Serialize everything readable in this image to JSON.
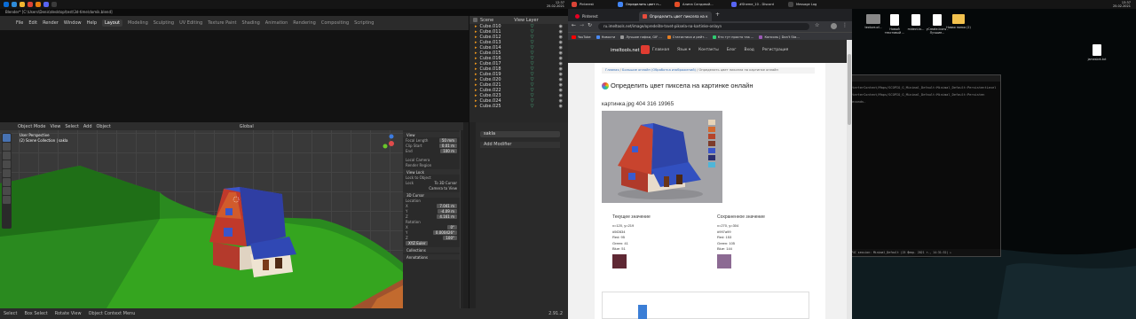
{
  "left_taskbar": {
    "clock_time": "12:37",
    "clock_date": "25.02.2021",
    "lang": "РУС"
  },
  "blender": {
    "window_title": "Blender* [C:\\Users\\Denis\\desktop\\test\\3d-time\\domik.blend]",
    "menus": [
      "File",
      "Edit",
      "Render",
      "Window",
      "Help"
    ],
    "workspaces": [
      "Layout",
      "Modeling",
      "Sculpting",
      "UV Editing",
      "Texture Paint",
      "Shading",
      "Animation",
      "Rendering",
      "Compositing",
      "Scripting"
    ],
    "outliner": {
      "header": "Scene",
      "view_layer": "View Layer",
      "items": [
        "Cube.010",
        "Cube.011",
        "Cube.012",
        "Cube.013",
        "Cube.014",
        "Cube.015",
        "Cube.016",
        "Cube.017",
        "Cube.018",
        "Cube.019",
        "Cube.020",
        "Cube.021",
        "Cube.022",
        "Cube.023",
        "Cube.024",
        "Cube.025"
      ]
    },
    "viewport": {
      "mode": "Object Mode",
      "header_menus": [
        "View",
        "Select",
        "Add",
        "Object"
      ],
      "shading": "Global",
      "info_line1": "User Perspective",
      "info_line2": "(2) Scene Collection | sakla",
      "npanel": {
        "view_header": "View",
        "focal_length_label": "Focal Length",
        "focal_length": "50 mm",
        "clip_start_label": "Clip Start",
        "clip_start": "0.01 m",
        "clip_end_label": "End",
        "clip_end": "100 m",
        "local_camera": "Local Camera",
        "render_region": "Render Region",
        "view_lock": "View Lock",
        "lock_to_object": "Lock to Object",
        "lock_label": "Lock",
        "to_3d_cursor": "To 3D Cursor",
        "camera_to_view": "Camera to View",
        "cursor_header": "3D Cursor",
        "location_label": "Location",
        "x": "7.041 m",
        "y": "-4.09 m",
        "z": "4.161 m",
        "rotation_label": "Rotation",
        "rx": "0°",
        "ry": "0.000426°",
        "rz": "100°",
        "rotation_mode": "XYZ Euler",
        "collections": "Collections",
        "annotations": "Annotations"
      }
    },
    "properties": {
      "search": "sakla",
      "add_modifier": "Add Modifier"
    },
    "status": {
      "select": "Select",
      "box_select": "Box Select",
      "rotate": "Rotate View",
      "object_menu": "Object Context Menu",
      "version": "2.91.2"
    }
  },
  "right_taskbar": {
    "apps": [
      "Pinterest",
      "Определить цвет п...",
      "Алина Сандовой...",
      "#Sheme_10 - Discord",
      "Message Log"
    ],
    "clock_time": "13:37",
    "clock_date": "25.02.2021"
  },
  "chrome": {
    "tabs": [
      "Pinterest",
      "Определить цвет пиксела на к"
    ],
    "url": "ru.imeltools.net/image/opredelite-tsvet-piksela-na-kartinke-onlayn",
    "bookmarks": [
      "YouTube",
      "Новости",
      "Лучшие гифки, GIF ...",
      "Статистика и рейт...",
      "Кто тут просто так ...",
      "Консоль | Don't Sta..."
    ]
  },
  "site": {
    "logo": "imeltools.net",
    "nav": [
      "Главная",
      "Язык ▾",
      "Контакты",
      "Блог",
      "Вход",
      "Регистрация"
    ],
    "breadcrumbs": [
      "Главная",
      "Большие онлайн (Обработка изображений)",
      "Определить цвет пиксела на картинке онлайн"
    ],
    "title": "Определить цвет пиксела на картинке онлайн",
    "file_info": "картинка.jpg 404 316 19965",
    "current": {
      "header": "Текущее значение",
      "coords": "x=120, y=219",
      "hex": "#5f2834",
      "red": "Red: 95",
      "green": "Green: 41",
      "blue": "Blue: 51",
      "color": "#5f2834"
    },
    "saved": {
      "header": "Сохраненное значение",
      "coords": "x=270, y=304",
      "hex": "#997a99",
      "red": "Red: 153",
      "green": "Green: 105",
      "blue": "Blue: 144",
      "color": "#8c6a93"
    }
  },
  "desktop": {
    "icons": [
      "texture.of...",
      "Новый текстовый ...",
      "mldect.tx...",
      "yCreate.Icons - Лучшие...",
      "Новая папка (2)",
      "jamesbrk.txt"
    ]
  },
  "terminal": {
    "lines": [
      "StarterContent/Maps/SCOPIO_G_Minimal_Default:Minimal_Default:PersistentLevel",
      "StarterContent/Maps/SCOPIO_G_Minimal_Default:Minimal_Default:Persisten",
      "seconds."
    ],
    "status": "P4C session: Minimal_Default (25 февр. 2021 r., 14:31:52) ▸"
  }
}
